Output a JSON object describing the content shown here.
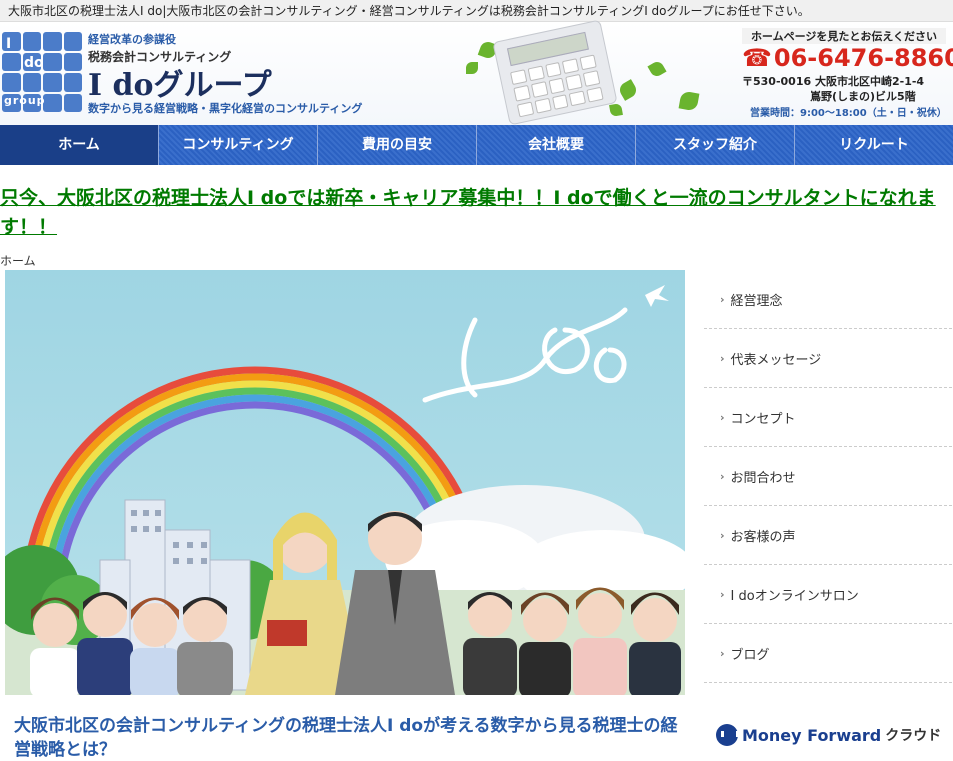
{
  "topbar": {
    "text": "大阪市北区の税理士法人I do|大阪市北区の会計コンサルティング・経営コンサルティングは税務会計コンサルティングI doグループにお任せ下さい。"
  },
  "header": {
    "logo": {
      "i": "I",
      "do": "do",
      "group": "group"
    },
    "tagline_top": "経営改革の参謀役",
    "tagline_mid": "税務会計コンサルティング",
    "brand": "I doグループ",
    "tagline_bottom": "数字から見る経営戦略・黒字化経営のコンサルティング",
    "contact_notice": "ホームページを見たとお伝えください",
    "phone": "06-6476-8860",
    "address_line1": "〒530-0016 大阪市北区中崎2-1-4",
    "address_line2": "嶌野(しまの)ビル5階",
    "hours": "営業時間：9:00～18:00（土・日・祝休）"
  },
  "nav": {
    "items": [
      {
        "label": "ホーム"
      },
      {
        "label": "コンサルティング"
      },
      {
        "label": "費用の目安"
      },
      {
        "label": "会社概要"
      },
      {
        "label": "スタッフ紹介"
      },
      {
        "label": "リクルート"
      }
    ]
  },
  "headline": "只今、大阪北区の税理士法人I doでは新卒・キャリア募集中！！I doで働くと一流のコンサルタントになれます！！",
  "breadcrumb": "ホーム",
  "sidebar": {
    "items": [
      {
        "label": "経営理念"
      },
      {
        "label": "代表メッセージ"
      },
      {
        "label": "コンセプト"
      },
      {
        "label": "お問合わせ"
      },
      {
        "label": "お客様の声"
      },
      {
        "label": "I doオンラインサロン"
      },
      {
        "label": "ブログ"
      }
    ]
  },
  "subheading": "大阪市北区の会計コンサルティングの税理士法人I doが考える数字から見る税理士の経営戦略とは？",
  "moneyforward": {
    "brand": "Money Forward",
    "suffix": "クラウド"
  },
  "colors": {
    "nav_bg": "#2a5fbf",
    "headline": "#007a00",
    "phone": "#d7271d",
    "sub": "#2a5ca8"
  }
}
